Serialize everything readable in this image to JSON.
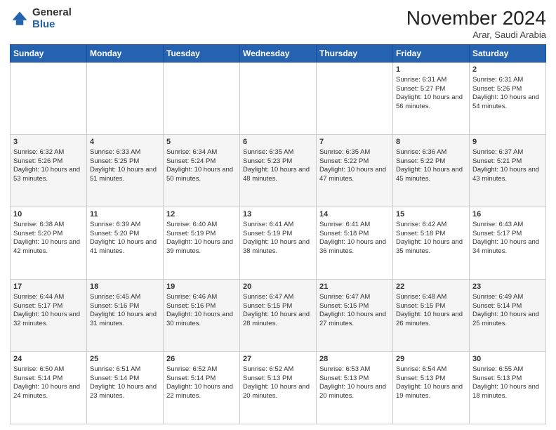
{
  "header": {
    "logo_general": "General",
    "logo_blue": "Blue",
    "month_title": "November 2024",
    "location": "Arar, Saudi Arabia"
  },
  "days_of_week": [
    "Sunday",
    "Monday",
    "Tuesday",
    "Wednesday",
    "Thursday",
    "Friday",
    "Saturday"
  ],
  "weeks": [
    [
      {
        "day": "",
        "sunrise": "",
        "sunset": "",
        "daylight": ""
      },
      {
        "day": "",
        "sunrise": "",
        "sunset": "",
        "daylight": ""
      },
      {
        "day": "",
        "sunrise": "",
        "sunset": "",
        "daylight": ""
      },
      {
        "day": "",
        "sunrise": "",
        "sunset": "",
        "daylight": ""
      },
      {
        "day": "",
        "sunrise": "",
        "sunset": "",
        "daylight": ""
      },
      {
        "day": "1",
        "sunrise": "Sunrise: 6:31 AM",
        "sunset": "Sunset: 5:27 PM",
        "daylight": "Daylight: 10 hours and 56 minutes."
      },
      {
        "day": "2",
        "sunrise": "Sunrise: 6:31 AM",
        "sunset": "Sunset: 5:26 PM",
        "daylight": "Daylight: 10 hours and 54 minutes."
      }
    ],
    [
      {
        "day": "3",
        "sunrise": "Sunrise: 6:32 AM",
        "sunset": "Sunset: 5:26 PM",
        "daylight": "Daylight: 10 hours and 53 minutes."
      },
      {
        "day": "4",
        "sunrise": "Sunrise: 6:33 AM",
        "sunset": "Sunset: 5:25 PM",
        "daylight": "Daylight: 10 hours and 51 minutes."
      },
      {
        "day": "5",
        "sunrise": "Sunrise: 6:34 AM",
        "sunset": "Sunset: 5:24 PM",
        "daylight": "Daylight: 10 hours and 50 minutes."
      },
      {
        "day": "6",
        "sunrise": "Sunrise: 6:35 AM",
        "sunset": "Sunset: 5:23 PM",
        "daylight": "Daylight: 10 hours and 48 minutes."
      },
      {
        "day": "7",
        "sunrise": "Sunrise: 6:35 AM",
        "sunset": "Sunset: 5:22 PM",
        "daylight": "Daylight: 10 hours and 47 minutes."
      },
      {
        "day": "8",
        "sunrise": "Sunrise: 6:36 AM",
        "sunset": "Sunset: 5:22 PM",
        "daylight": "Daylight: 10 hours and 45 minutes."
      },
      {
        "day": "9",
        "sunrise": "Sunrise: 6:37 AM",
        "sunset": "Sunset: 5:21 PM",
        "daylight": "Daylight: 10 hours and 43 minutes."
      }
    ],
    [
      {
        "day": "10",
        "sunrise": "Sunrise: 6:38 AM",
        "sunset": "Sunset: 5:20 PM",
        "daylight": "Daylight: 10 hours and 42 minutes."
      },
      {
        "day": "11",
        "sunrise": "Sunrise: 6:39 AM",
        "sunset": "Sunset: 5:20 PM",
        "daylight": "Daylight: 10 hours and 41 minutes."
      },
      {
        "day": "12",
        "sunrise": "Sunrise: 6:40 AM",
        "sunset": "Sunset: 5:19 PM",
        "daylight": "Daylight: 10 hours and 39 minutes."
      },
      {
        "day": "13",
        "sunrise": "Sunrise: 6:41 AM",
        "sunset": "Sunset: 5:19 PM",
        "daylight": "Daylight: 10 hours and 38 minutes."
      },
      {
        "day": "14",
        "sunrise": "Sunrise: 6:41 AM",
        "sunset": "Sunset: 5:18 PM",
        "daylight": "Daylight: 10 hours and 36 minutes."
      },
      {
        "day": "15",
        "sunrise": "Sunrise: 6:42 AM",
        "sunset": "Sunset: 5:18 PM",
        "daylight": "Daylight: 10 hours and 35 minutes."
      },
      {
        "day": "16",
        "sunrise": "Sunrise: 6:43 AM",
        "sunset": "Sunset: 5:17 PM",
        "daylight": "Daylight: 10 hours and 34 minutes."
      }
    ],
    [
      {
        "day": "17",
        "sunrise": "Sunrise: 6:44 AM",
        "sunset": "Sunset: 5:17 PM",
        "daylight": "Daylight: 10 hours and 32 minutes."
      },
      {
        "day": "18",
        "sunrise": "Sunrise: 6:45 AM",
        "sunset": "Sunset: 5:16 PM",
        "daylight": "Daylight: 10 hours and 31 minutes."
      },
      {
        "day": "19",
        "sunrise": "Sunrise: 6:46 AM",
        "sunset": "Sunset: 5:16 PM",
        "daylight": "Daylight: 10 hours and 30 minutes."
      },
      {
        "day": "20",
        "sunrise": "Sunrise: 6:47 AM",
        "sunset": "Sunset: 5:15 PM",
        "daylight": "Daylight: 10 hours and 28 minutes."
      },
      {
        "day": "21",
        "sunrise": "Sunrise: 6:47 AM",
        "sunset": "Sunset: 5:15 PM",
        "daylight": "Daylight: 10 hours and 27 minutes."
      },
      {
        "day": "22",
        "sunrise": "Sunrise: 6:48 AM",
        "sunset": "Sunset: 5:15 PM",
        "daylight": "Daylight: 10 hours and 26 minutes."
      },
      {
        "day": "23",
        "sunrise": "Sunrise: 6:49 AM",
        "sunset": "Sunset: 5:14 PM",
        "daylight": "Daylight: 10 hours and 25 minutes."
      }
    ],
    [
      {
        "day": "24",
        "sunrise": "Sunrise: 6:50 AM",
        "sunset": "Sunset: 5:14 PM",
        "daylight": "Daylight: 10 hours and 24 minutes."
      },
      {
        "day": "25",
        "sunrise": "Sunrise: 6:51 AM",
        "sunset": "Sunset: 5:14 PM",
        "daylight": "Daylight: 10 hours and 23 minutes."
      },
      {
        "day": "26",
        "sunrise": "Sunrise: 6:52 AM",
        "sunset": "Sunset: 5:14 PM",
        "daylight": "Daylight: 10 hours and 22 minutes."
      },
      {
        "day": "27",
        "sunrise": "Sunrise: 6:52 AM",
        "sunset": "Sunset: 5:13 PM",
        "daylight": "Daylight: 10 hours and 20 minutes."
      },
      {
        "day": "28",
        "sunrise": "Sunrise: 6:53 AM",
        "sunset": "Sunset: 5:13 PM",
        "daylight": "Daylight: 10 hours and 20 minutes."
      },
      {
        "day": "29",
        "sunrise": "Sunrise: 6:54 AM",
        "sunset": "Sunset: 5:13 PM",
        "daylight": "Daylight: 10 hours and 19 minutes."
      },
      {
        "day": "30",
        "sunrise": "Sunrise: 6:55 AM",
        "sunset": "Sunset: 5:13 PM",
        "daylight": "Daylight: 10 hours and 18 minutes."
      }
    ]
  ]
}
